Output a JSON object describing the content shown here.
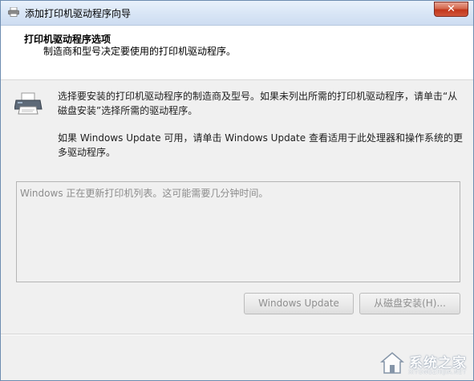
{
  "window": {
    "title": "添加打印机驱动程序向导",
    "close_glyph": "✕"
  },
  "header": {
    "title": "打印机驱动程序选项",
    "subtitle": "制造商和型号决定要使用的打印机驱动程序。"
  },
  "body": {
    "description_1": "选择要安装的打印机驱动程序的制造商及型号。如果未列出所需的打印机驱动程序，请单击“从磁盘安装”选择所需的驱动程序。",
    "description_2": "如果 Windows Update 可用，请单击 Windows Update 查看适用于此处理器和操作系统的更多驱动程序。",
    "list_status": "Windows 正在更新打印机列表。这可能需要几分钟时间。"
  },
  "buttons": {
    "windows_update": "Windows Update",
    "install_from_disk": "从磁盘安装(H)..."
  },
  "watermark": {
    "text": "系统之家",
    "url": "XITONGZHIJIA.NET"
  },
  "icons": {
    "title": "printer-wizard-icon",
    "printer": "printer-icon",
    "watermark_logo": "house-logo-icon"
  },
  "colors": {
    "window_bg": "#f0f0f0",
    "header_bg": "#ffffff",
    "close_button": "#c2361a",
    "disabled_text": "#8f8f8f"
  }
}
